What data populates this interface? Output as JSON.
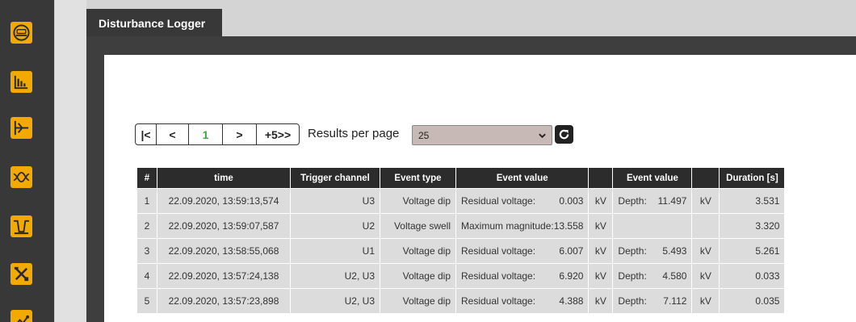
{
  "window": {
    "tab_title": "Disturbance Logger"
  },
  "colors": {
    "accent": "#f2a900",
    "sidebar_bg": "#383838",
    "header_bg": "#2c2c2c",
    "current_page": "#3aa83a"
  },
  "sidebar": {
    "items": [
      {
        "icon": "meter-icon"
      },
      {
        "icon": "bar-chart-icon"
      },
      {
        "icon": "phasor-icon"
      },
      {
        "icon": "waveform-icon"
      },
      {
        "icon": "dip-icon"
      },
      {
        "icon": "tools-icon"
      },
      {
        "icon": "graph-icon"
      }
    ]
  },
  "pagination": {
    "first": "|<",
    "prev": "<",
    "current": "1",
    "next": ">",
    "skip": "+5>>"
  },
  "results_per_page": {
    "label": "Results per page",
    "value": "25"
  },
  "table": {
    "headers": [
      "#",
      "time",
      "Trigger channel",
      "Event type",
      "Event value",
      "",
      "Event value",
      "",
      "Duration [s]"
    ],
    "rows": [
      {
        "n": "1",
        "time": "22.09.2020, 13:59:13,574",
        "channel": "U3",
        "type": "Voltage dip",
        "ev1_label": "Residual voltage:",
        "ev1_value": "0.003",
        "ev1_unit": "kV",
        "ev2_label": "Depth:",
        "ev2_value": "11.497",
        "ev2_unit": "kV",
        "duration": "3.531"
      },
      {
        "n": "2",
        "time": "22.09.2020, 13:59:07,587",
        "channel": "U2",
        "type": "Voltage swell",
        "ev1_label": "Maximum magnitude:",
        "ev1_value": "13.558",
        "ev1_unit": "kV",
        "ev2_label": "",
        "ev2_value": "",
        "ev2_unit": "",
        "duration": "3.320"
      },
      {
        "n": "3",
        "time": "22.09.2020, 13:58:55,068",
        "channel": "U1",
        "type": "Voltage dip",
        "ev1_label": "Residual voltage:",
        "ev1_value": "6.007",
        "ev1_unit": "kV",
        "ev2_label": "Depth:",
        "ev2_value": "5.493",
        "ev2_unit": "kV",
        "duration": "5.261"
      },
      {
        "n": "4",
        "time": "22.09.2020, 13:57:24,138",
        "channel": "U2, U3",
        "type": "Voltage dip",
        "ev1_label": "Residual voltage:",
        "ev1_value": "6.920",
        "ev1_unit": "kV",
        "ev2_label": "Depth:",
        "ev2_value": "4.580",
        "ev2_unit": "kV",
        "duration": "0.033"
      },
      {
        "n": "5",
        "time": "22.09.2020, 13:57:23,898",
        "channel": "U2, U3",
        "type": "Voltage dip",
        "ev1_label": "Residual voltage:",
        "ev1_value": "4.388",
        "ev1_unit": "kV",
        "ev2_label": "Depth:",
        "ev2_value": "7.112",
        "ev2_unit": "kV",
        "duration": "0.035"
      }
    ]
  }
}
